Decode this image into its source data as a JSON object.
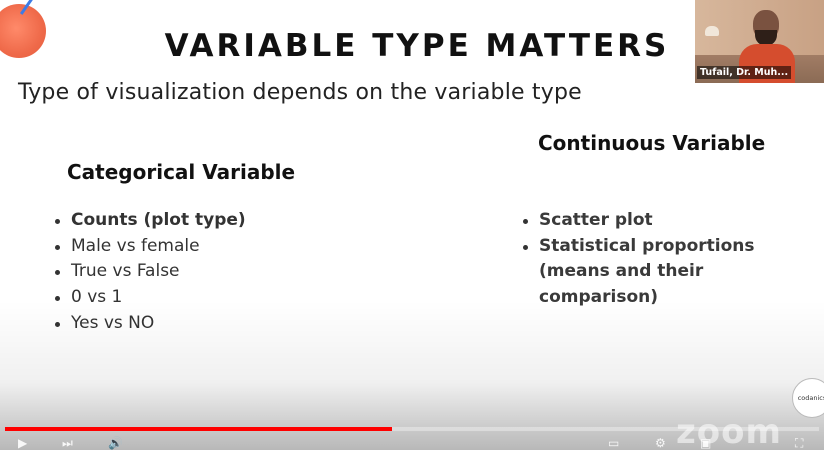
{
  "slide": {
    "title": "VARIABLE TYPE MATTERS",
    "subtitle": "Type of visualization depends on the variable type",
    "categorical": {
      "heading": "Categorical Variable",
      "items": [
        {
          "text": "Counts (plot type)"
        },
        {
          "text": "Male vs female"
        },
        {
          "text": "True vs False"
        },
        {
          "text": "0 vs 1"
        },
        {
          "text": "Yes vs NO"
        }
      ]
    },
    "continuous": {
      "heading": "Continuous Variable",
      "items": [
        {
          "text": "Scatter plot"
        },
        {
          "text": "Statistical proportions (means and their comparison)"
        }
      ]
    }
  },
  "participant": {
    "name": "Tufail, Dr. Muh..."
  },
  "logo": {
    "text": "codanics"
  },
  "watermark": {
    "text": "zoom"
  },
  "player": {
    "progress_percent": 47.5,
    "progress_color": "#ff0000",
    "icons": [
      "play-icon",
      "next-icon",
      "volume-icon",
      "subtitles-icon",
      "settings-icon",
      "miniplayer-icon",
      "fullscreen-icon"
    ]
  }
}
